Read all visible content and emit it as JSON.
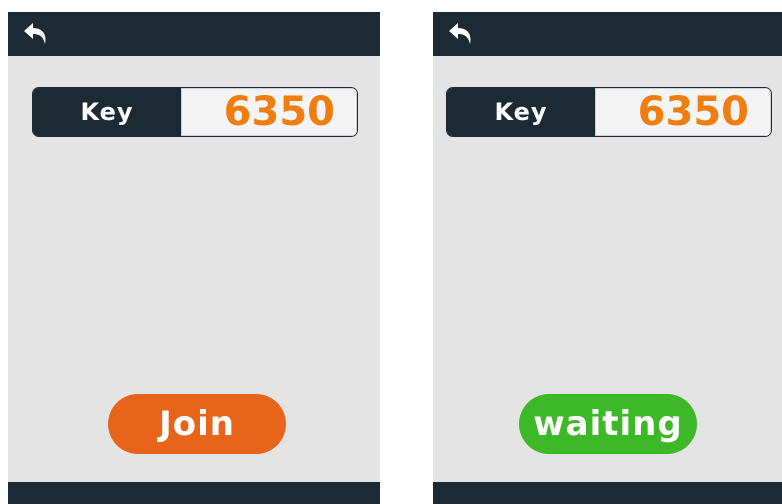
{
  "screens": [
    {
      "key_label": "Key",
      "key_value": "6350",
      "action_label": "Join",
      "action_color": "#e8641a"
    },
    {
      "key_label": "Key",
      "key_value": "6350",
      "action_label": "waiting",
      "action_color": "#3cb829"
    }
  ],
  "colors": {
    "bar": "#1c2a33",
    "background": "#e4e4e4",
    "key_value": "#f07d10"
  },
  "icons": {
    "back": "back-arrow-icon"
  }
}
